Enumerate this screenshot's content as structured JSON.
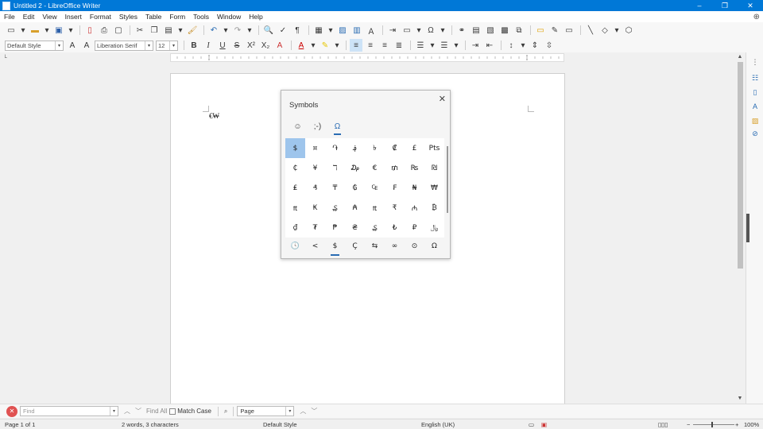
{
  "window": {
    "title": "Untitled 2 - LibreOffice Writer",
    "minimize": "–",
    "maximize": "❐",
    "close": "✕"
  },
  "menu": [
    "File",
    "Edit",
    "View",
    "Insert",
    "Format",
    "Styles",
    "Table",
    "Form",
    "Tools",
    "Window",
    "Help"
  ],
  "toolbar_format": {
    "paragraph_style": "Default Style",
    "font_name": "Liberation Serif",
    "font_size": "12"
  },
  "document": {
    "text": "€₩"
  },
  "symbols_popup": {
    "title": "Symbols",
    "tabs": [
      {
        "name": "emoji",
        "label": "☺"
      },
      {
        "name": "emoticons",
        "label": ";-)"
      },
      {
        "name": "symbols",
        "label": "Ω"
      }
    ],
    "grid": [
      [
        "$",
        "¤",
        "֏",
        "؋",
        "৳",
        "₡",
        "£",
        "Pts"
      ],
      [
        "₵",
        "¥",
        "ℸ",
        "₯",
        "€",
        "₥",
        "₨",
        "₪"
      ],
      [
        "₤",
        "₰",
        "₸",
        "₲",
        "₠",
        "₣",
        "₦",
        "₩"
      ],
      [
        "₶",
        "₭",
        "₷",
        "₳",
        "₶",
        "₹",
        "₼",
        "₿"
      ],
      [
        "₫",
        "₮",
        "₱",
        "₴",
        "₷",
        "₺",
        "₽",
        "﷼"
      ]
    ],
    "recent": [
      "🕓",
      "<",
      "$",
      "Ç",
      "⇆",
      "∞",
      "⊙",
      "Ω"
    ]
  },
  "find_bar": {
    "placeholder": "Find",
    "find_all": "Find All",
    "match_case": "Match Case",
    "search_scope": "Page"
  },
  "status_bar": {
    "page": "Page 1 of 1",
    "word_count": "2 words, 3 characters",
    "page_style": "Default Style",
    "language": "English (UK)",
    "zoom": "100%"
  }
}
